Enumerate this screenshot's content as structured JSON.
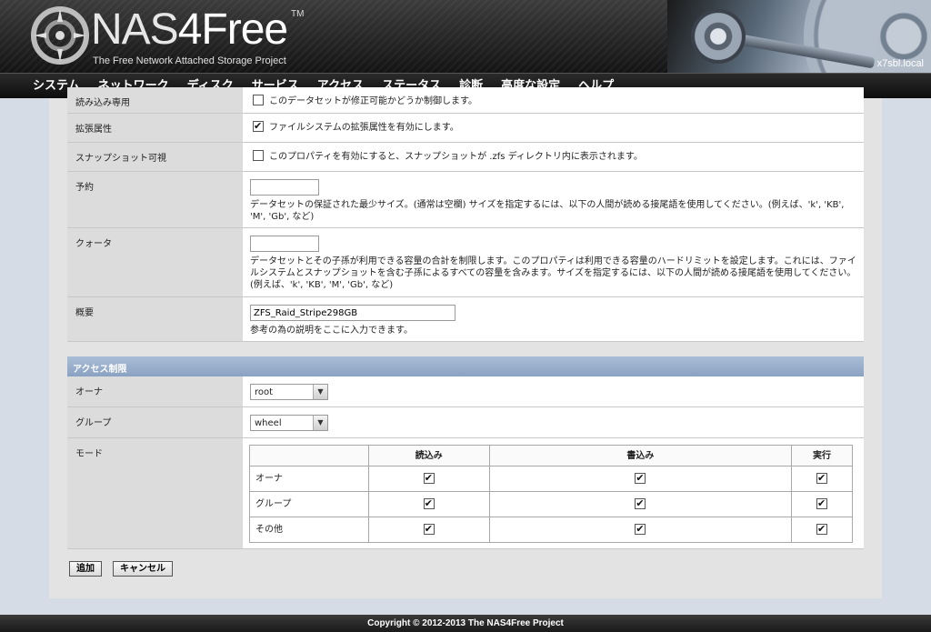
{
  "header": {
    "logo_prefix": "NAS",
    "logo_suffix": "4Free",
    "trademark": "TM",
    "tagline": "The Free Network Attached Storage Project",
    "hostname": "x7sbl.local"
  },
  "nav": {
    "items": [
      "システム",
      "ネットワーク",
      "ディスク",
      "サービス",
      "アクセス",
      "ステータス",
      "診断",
      "高度な設定",
      "ヘルプ"
    ]
  },
  "form": {
    "readonly": {
      "label": "読み込み専用",
      "text": "このデータセットが修正可能かどうか制御します。",
      "checked": false
    },
    "xattr": {
      "label": "拡張属性",
      "text": "ファイルシステムの拡張属性を有効にします。",
      "checked": true
    },
    "snapdir": {
      "label": "スナップショット可視",
      "text": "このプロパティを有効にすると、スナップショットが .zfs ディレクトリ内に表示されます。",
      "checked": false
    },
    "reservation": {
      "label": "予約",
      "value": "",
      "help": "データセットの保証された最少サイズ。(通常は空欄) サイズを指定するには、以下の人間が読める接尾語を使用してください。(例えば、'k', 'KB', 'M', 'Gb', など)"
    },
    "quota": {
      "label": "クォータ",
      "value": "",
      "help": "データセットとその子孫が利用できる容量の合計を制限します。このプロパティは利用できる容量のハードリミットを設定します。これには、ファイルシステムとスナップショットを含む子孫によるすべての容量を含みます。サイズを指定するには、以下の人間が読める接尾語を使用してください。(例えば、'k', 'KB', 'M', 'Gb', など)"
    },
    "description": {
      "label": "概要",
      "value": "ZFS_Raid_Stripe298GB",
      "help": "参考の為の説明をここに入力できます。"
    }
  },
  "access": {
    "section_title": "アクセス制限",
    "owner": {
      "label": "オーナ",
      "selected": "root"
    },
    "group": {
      "label": "グループ",
      "selected": "wheel"
    },
    "mode": {
      "label": "モード",
      "columns": [
        "",
        "読込み",
        "書込み",
        "実行"
      ],
      "rows": [
        {
          "name": "オーナ",
          "read": true,
          "write": true,
          "exec": true
        },
        {
          "name": "グループ",
          "read": true,
          "write": true,
          "exec": true
        },
        {
          "name": "その他",
          "read": true,
          "write": true,
          "exec": true
        }
      ]
    }
  },
  "buttons": {
    "add": "追加",
    "cancel": "キャンセル"
  },
  "footer": {
    "copyright": "Copyright © 2012-2013 The NAS4Free Project"
  }
}
